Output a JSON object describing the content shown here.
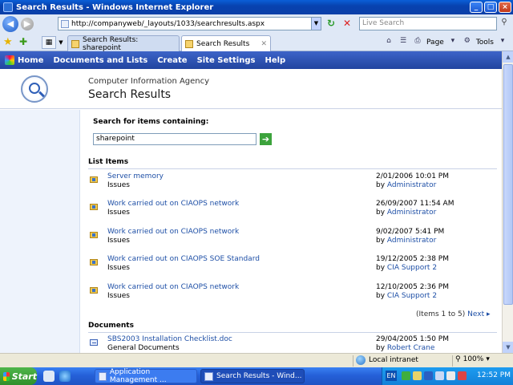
{
  "window": {
    "title": "Search Results - Windows Internet Explorer"
  },
  "browser": {
    "url": "http://companyweb/_layouts/1033/searchresults.aspx",
    "live_search_placeholder": "Live Search",
    "tabs": [
      {
        "label": "Search Results: sharepoint"
      },
      {
        "label": "Search Results"
      }
    ],
    "commands": {
      "page": "Page",
      "tools": "Tools"
    }
  },
  "nav": {
    "items": [
      "Home",
      "Documents and Lists",
      "Create",
      "Site Settings",
      "Help"
    ]
  },
  "header": {
    "site_name": "Computer Information Agency",
    "page_title": "Search Results"
  },
  "search": {
    "label": "Search for items containing:",
    "value": "sharepoint"
  },
  "list_items": {
    "title": "List Items",
    "results": [
      {
        "title": "Server memory",
        "source": "Issues",
        "date": "2/01/2006 10:01 PM",
        "by": "by",
        "author": "Administrator"
      },
      {
        "title": "Work carried out on CIAOPS network",
        "source": "Issues",
        "date": "26/09/2007 11:54 AM",
        "by": "by",
        "author": "Administrator"
      },
      {
        "title": "Work carried out on CIAOPS network",
        "source": "Issues",
        "date": "9/02/2007 5:41 PM",
        "by": "by",
        "author": "Administrator"
      },
      {
        "title": "Work carried out on CIAOPS SOE Standard",
        "source": "Issues",
        "date": "19/12/2005 2:38 PM",
        "by": "by",
        "author": "CIA Support 2"
      },
      {
        "title": "Work carried out on CIAOPS network",
        "source": "Issues",
        "date": "12/10/2005 2:36 PM",
        "by": "by",
        "author": "CIA Support 2"
      }
    ],
    "pager_text": "(Items 1 to 5)",
    "pager_next": "Next ▸"
  },
  "documents": {
    "title": "Documents",
    "results": [
      {
        "title": "SBS2003 Installation Checklist.doc",
        "source": "General Documents",
        "date": "29/04/2005 1:50 PM",
        "by": "by",
        "author": "Robert Crane"
      }
    ]
  },
  "status": {
    "zone": "Local intranet",
    "zoom": "100%"
  },
  "taskbar": {
    "start": "Start",
    "tasks": [
      "Application Management ...",
      "Search Results - Wind..."
    ],
    "lang": "EN",
    "clock": "12:52 PM"
  }
}
